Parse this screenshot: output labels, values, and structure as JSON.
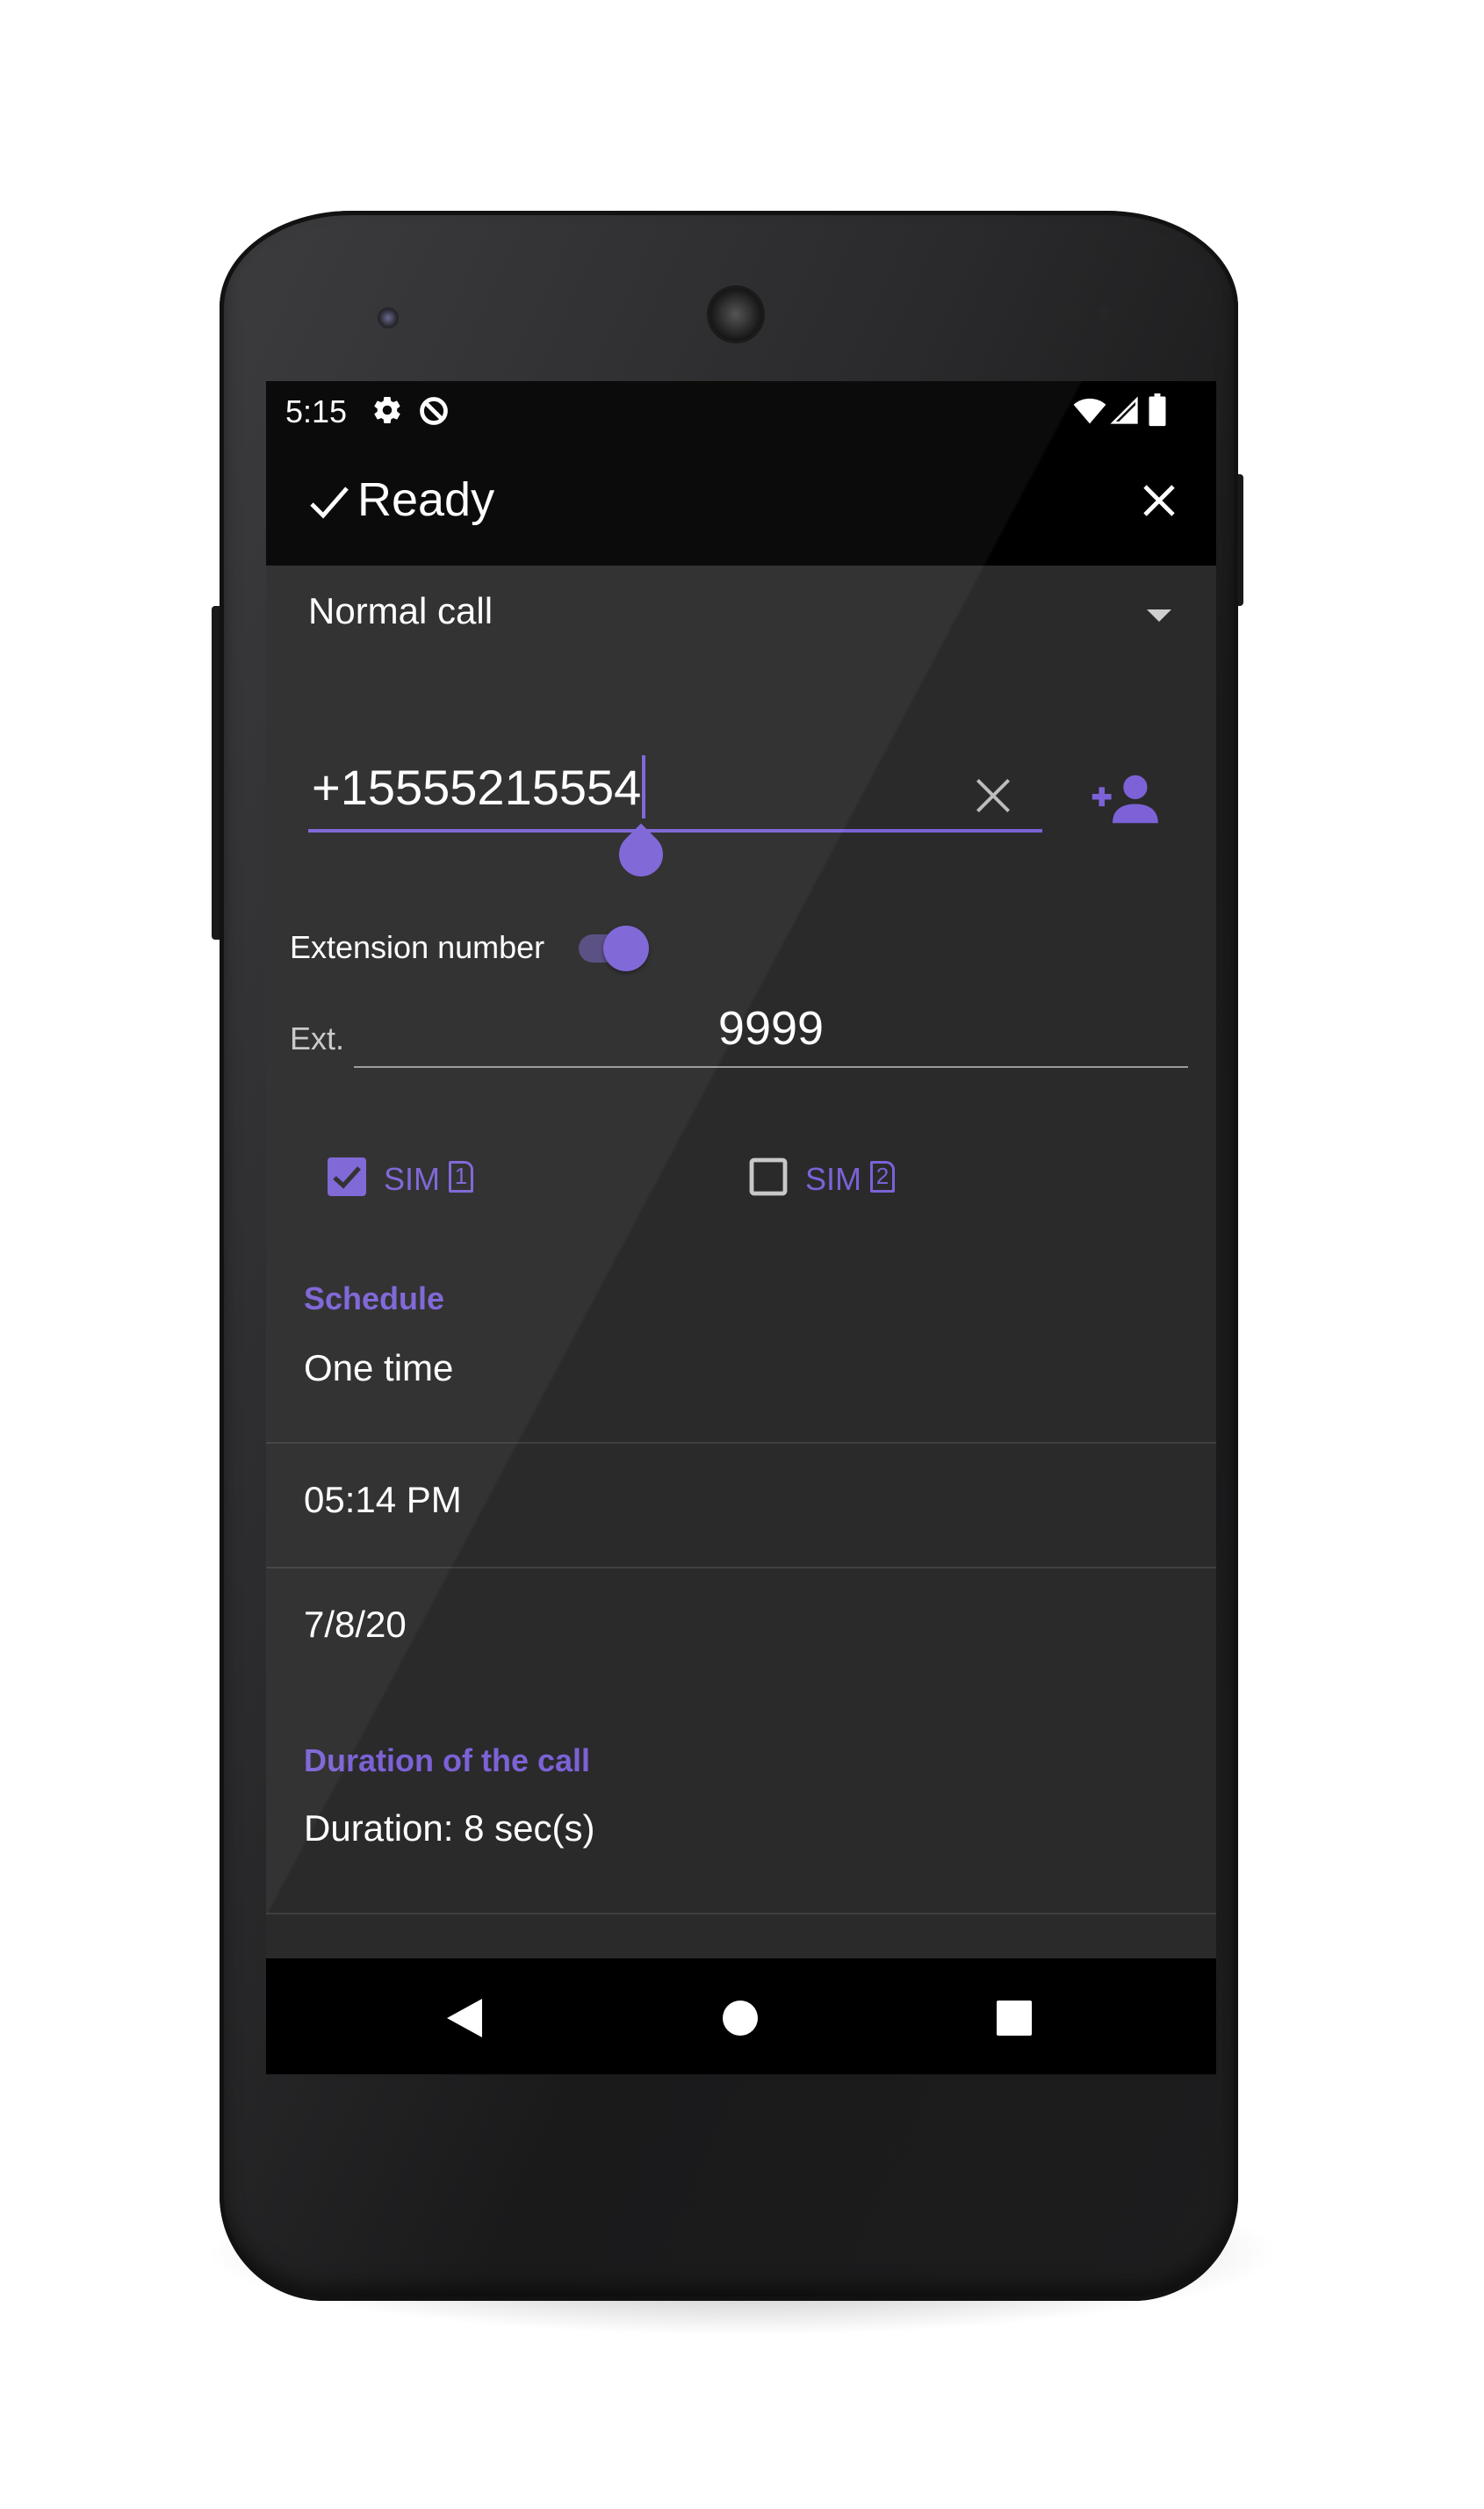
{
  "status_bar": {
    "time": "5:15",
    "icons": [
      "gear-icon",
      "data-saver-icon",
      "wifi-icon",
      "signal-icon",
      "battery-icon"
    ]
  },
  "toolbar": {
    "title": "Ready",
    "check_icon": "check-icon",
    "close_icon": "close-icon"
  },
  "form": {
    "call_type": "Normal call",
    "phone_number": "+15555215554",
    "extension_label": "Extension number",
    "extension_enabled": true,
    "ext_prefix": "Ext.",
    "ext_value": "9999",
    "sim1": {
      "label": "SIM",
      "slot": "1",
      "checked": true
    },
    "sim2": {
      "label": "SIM",
      "slot": "2",
      "checked": false
    }
  },
  "schedule": {
    "header": "Schedule",
    "repeat": "One time",
    "time": "05:14 PM",
    "date": "7/8/20"
  },
  "duration": {
    "header": "Duration of the call",
    "value": "Duration: 8 sec(s)"
  },
  "colors": {
    "accent": "#7c62d6",
    "background": "#2a2a2b",
    "bars": "#000000"
  }
}
